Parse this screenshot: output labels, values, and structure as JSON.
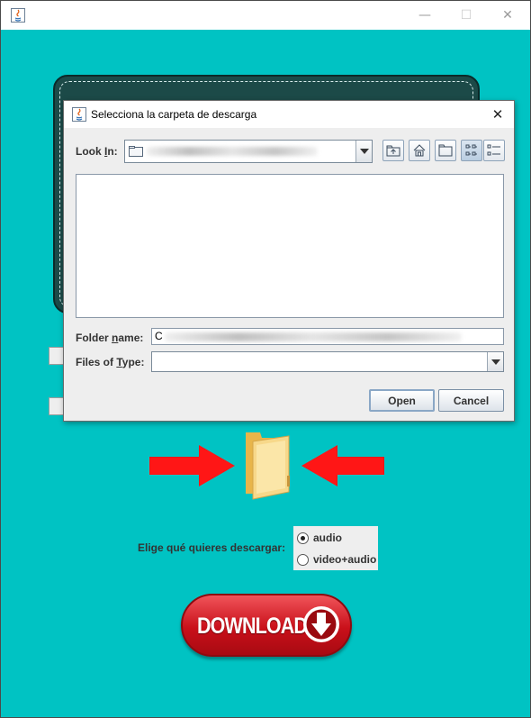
{
  "window": {
    "title": "",
    "controls": {
      "minimize": "—",
      "maximize": "☐",
      "close": "✕"
    }
  },
  "main": {
    "choose_label": "Elige qué quieres descargar:",
    "radio_options": [
      {
        "label": "audio",
        "selected": true
      },
      {
        "label": "video+audio",
        "selected": false
      }
    ],
    "download_label": "DOWNLOAD",
    "colors": {
      "background": "#00c3c3",
      "download_red": "#d1121c",
      "arrow_red": "#ff1a1a"
    }
  },
  "dialog": {
    "title": "Selecciona la carpeta de descarga",
    "close": "✕",
    "look_in_label_pre": "Look ",
    "look_in_label_accel": "I",
    "look_in_label_post": "n:",
    "folder_name_label_pre": "Folder ",
    "folder_name_label_accel": "n",
    "folder_name_label_post": "ame:",
    "folder_name_value_prefix": "C",
    "files_of_type_label_pre": "Files of ",
    "files_of_type_label_accel": "T",
    "files_of_type_label_post": "ype:",
    "open_button": "Open",
    "cancel_button": "Cancel",
    "toolbar_icons": [
      "up-folder-icon",
      "home-icon",
      "new-folder-icon",
      "list-view-icon",
      "details-view-icon"
    ]
  }
}
